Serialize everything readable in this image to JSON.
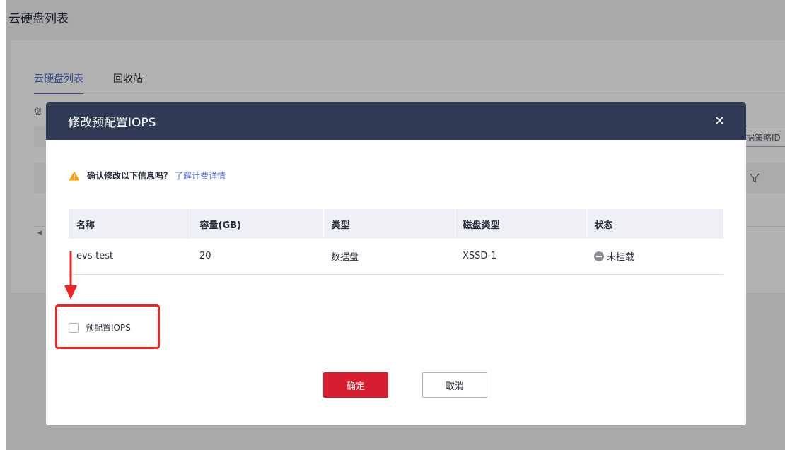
{
  "page": {
    "title": "云硬盘列表",
    "tabs": [
      {
        "label": "云硬盘列表",
        "active": true
      },
      {
        "label": "回收站",
        "active": false
      }
    ],
    "hint_fragment": "您",
    "search_tail": "据策略ID",
    "filter_icon": "filter-icon"
  },
  "dialog": {
    "title": "修改预配置IOPS",
    "close_icon": "close-icon",
    "confirm_text": "确认修改以下信息吗？",
    "confirm_link": "了解计费详情",
    "warning_color": "#ff9b00",
    "table": {
      "headers": [
        "名称",
        "容量(GB)",
        "类型",
        "磁盘类型",
        "状态"
      ],
      "rows": [
        [
          "evs-test",
          "20",
          "数据盘",
          "XSSD-1",
          "未挂载"
        ]
      ]
    },
    "checkbox_label": "预配置IOPS",
    "checkbox_checked": false,
    "confirm_button": "确定",
    "cancel_button": "取消"
  },
  "colors": {
    "header_bg": "#2f3a55",
    "primary_button": "#d51d2f",
    "link": "#526ecc",
    "annotation": "#ec2724"
  }
}
